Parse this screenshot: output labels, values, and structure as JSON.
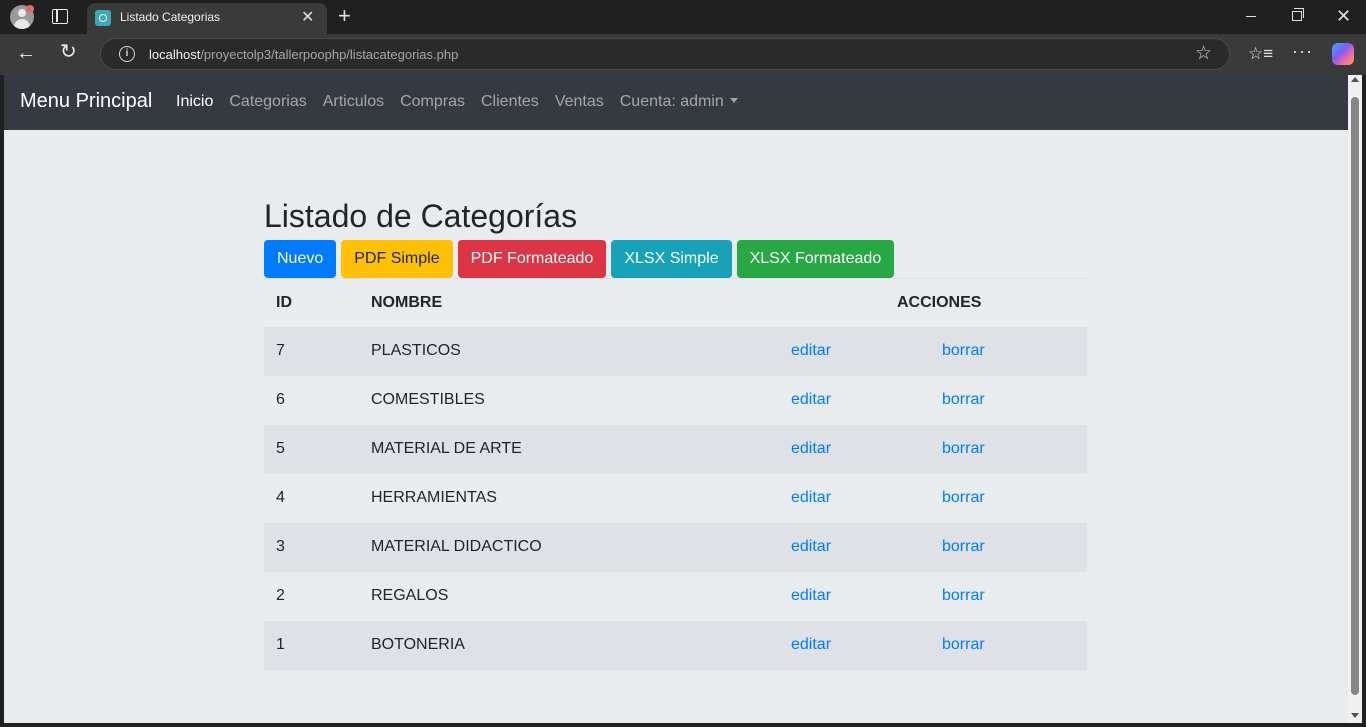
{
  "browser": {
    "tab_title": "Listado Categorias",
    "url_host": "localhost",
    "url_path": "/proyectolp3/tallerpoophp/listacategorias.php"
  },
  "navbar": {
    "brand": "Menu Principal",
    "links": [
      "Inicio",
      "Categorias",
      "Articulos",
      "Compras",
      "Clientes",
      "Ventas"
    ],
    "account": "Cuenta: admin"
  },
  "page": {
    "title": "Listado de Categorías",
    "buttons": {
      "nuevo": "Nuevo",
      "pdf_simple": "PDF Simple",
      "pdf_formateado": "PDF Formateado",
      "xlsx_simple": "XLSX Simple",
      "xlsx_formateado": "XLSX Formateado"
    },
    "table": {
      "headers": {
        "id": "ID",
        "nombre": "NOMBRE",
        "acciones": "ACCIONES"
      },
      "edit_label": "editar",
      "delete_label": "borrar",
      "rows": [
        {
          "id": "7",
          "nombre": "PLASTICOS"
        },
        {
          "id": "6",
          "nombre": "COMESTIBLES"
        },
        {
          "id": "5",
          "nombre": "MATERIAL DE ARTE"
        },
        {
          "id": "4",
          "nombre": "HERRAMIENTAS"
        },
        {
          "id": "3",
          "nombre": "MATERIAL DIDACTICO"
        },
        {
          "id": "2",
          "nombre": "REGALOS"
        },
        {
          "id": "1",
          "nombre": "BOTONERIA"
        }
      ]
    }
  }
}
